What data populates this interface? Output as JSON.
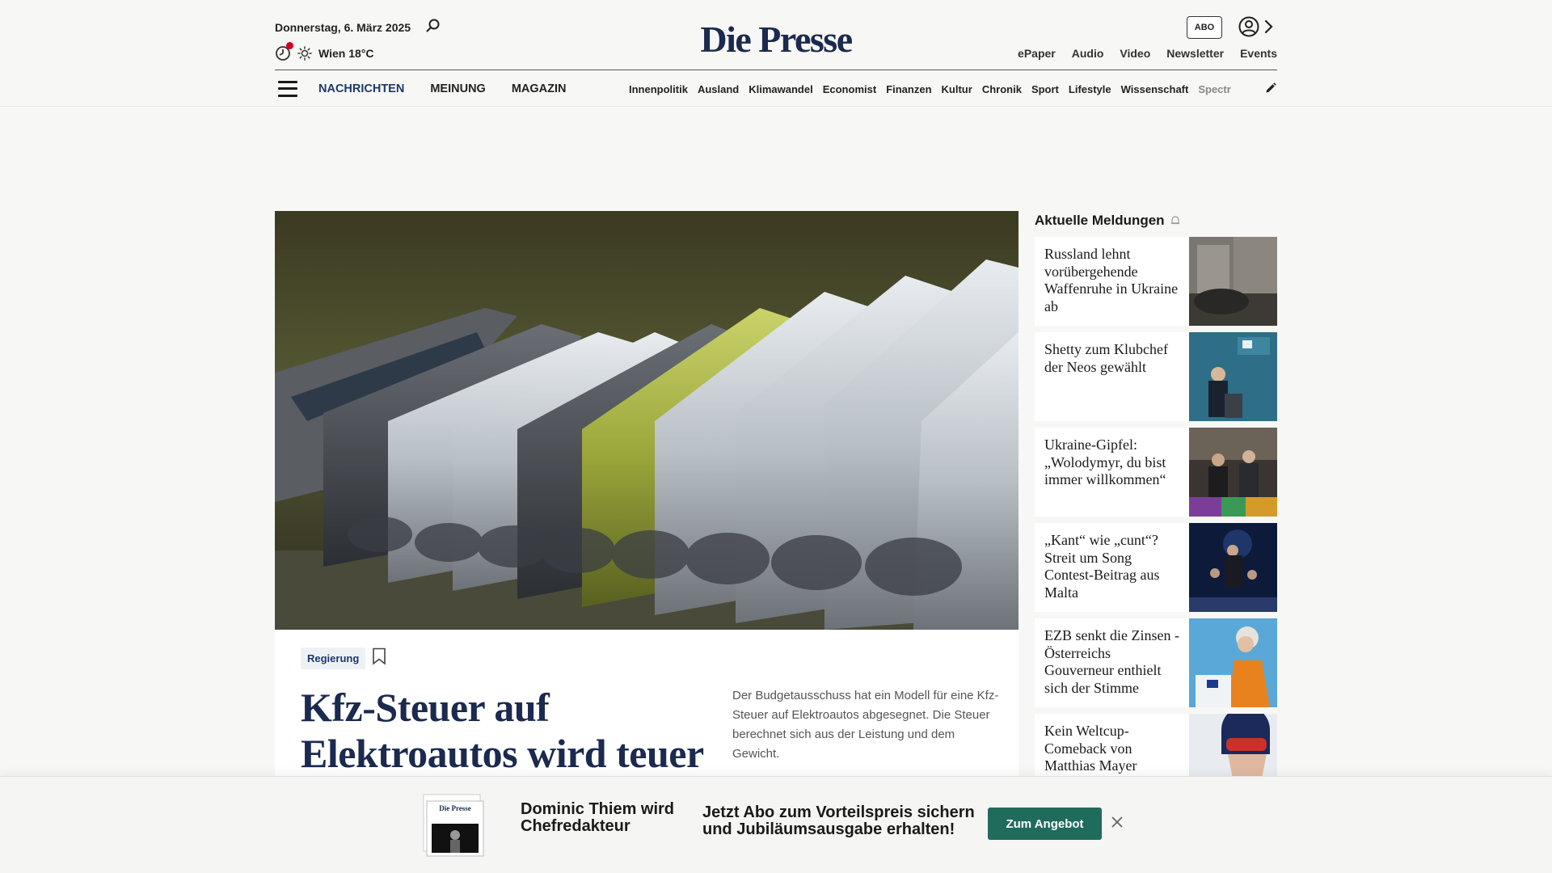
{
  "header": {
    "date": "Donnerstag, 6. März 2025",
    "weather": "Wien 18°C",
    "logo": "Die Presse",
    "abo_label": "ABO",
    "top_links": [
      "ePaper",
      "Audio",
      "Video",
      "Newsletter",
      "Events"
    ]
  },
  "nav": {
    "main": [
      "NACHRICHTEN",
      "MEINUNG",
      "MAGAZIN"
    ],
    "active": "NACHRICHTEN",
    "sub": [
      "Innenpolitik",
      "Ausland",
      "Klimawandel",
      "Economist",
      "Finanzen",
      "Kultur",
      "Chronik",
      "Sport",
      "Lifestyle",
      "Wissenschaft",
      "Spectr"
    ]
  },
  "article": {
    "tag": "Regierung",
    "headline": "Kfz-Steuer auf Elektroautos wird teuer",
    "teaser": "Der Budgetausschuss hat ein Modell für eine Kfz-Steuer auf Elektroautos abgesegnet. Die Steuer berechnet sich aus der Leistung und dem Gewicht."
  },
  "sidebar": {
    "title": "Aktuelle Meldungen",
    "items": [
      {
        "title": "Russland lehnt vorübergehende Waffenruhe in Ukraine ab"
      },
      {
        "title": "Shetty zum Klubchef der Neos gewählt"
      },
      {
        "title": "Ukraine-Gipfel: „Wolodymyr, du bist immer willkommen“"
      },
      {
        "title": "„Kant“ wie „cunt“? Streit um Song Contest-Beitrag aus Malta"
      },
      {
        "title": "EZB senkt die Zinsen - Österreichs Gouverneur enthielt sich der Stimme"
      },
      {
        "title": "Kein Weltcup-Comeback von Matthias Mayer"
      }
    ]
  },
  "promo": {
    "name": "Dominic Thiem wird Chefredakteur",
    "text": "Jetzt Abo zum Vorteilspreis sichern und Jubiläumsausgabe erhalten!",
    "button": "Zum Angebot",
    "thumb_logo": "Die Presse"
  },
  "colors": {
    "brand": "#1b2a4e",
    "accent": "#1f6b5c",
    "live": "#d0021b"
  }
}
